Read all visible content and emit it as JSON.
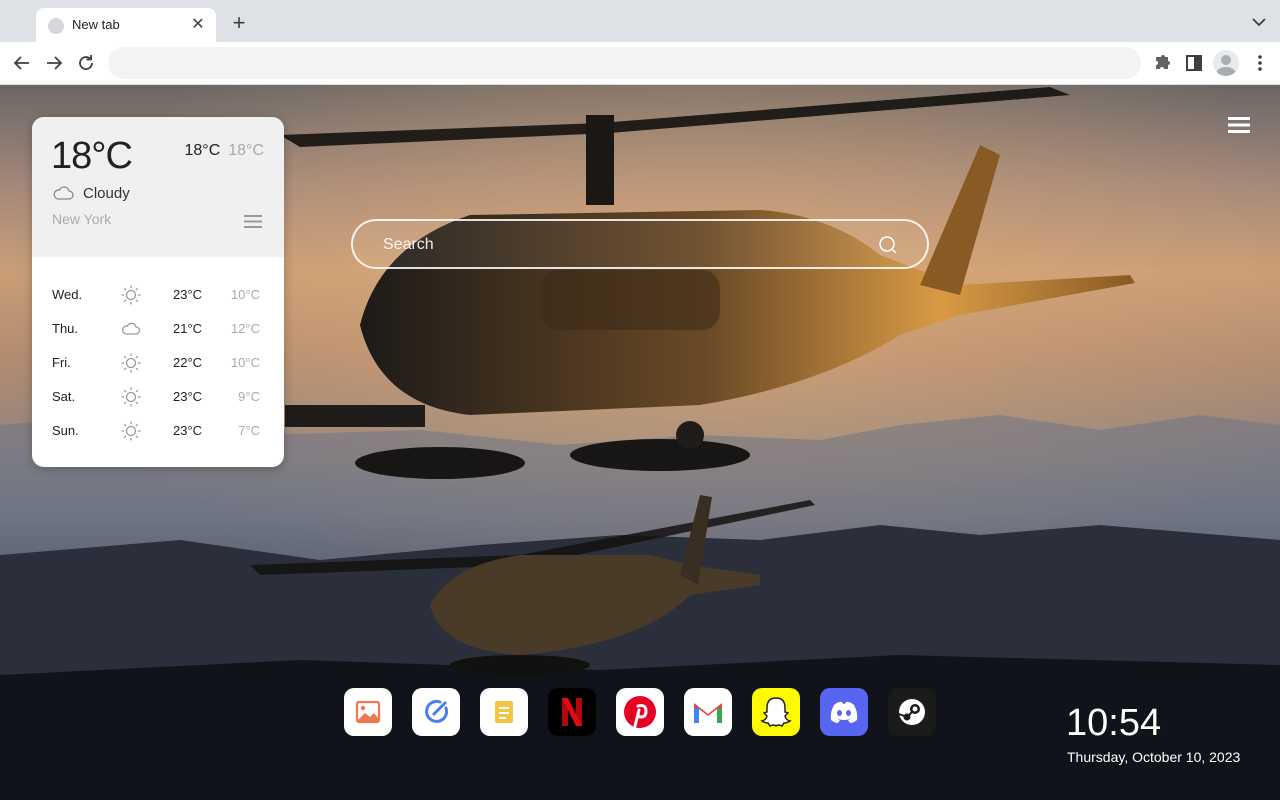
{
  "browser": {
    "tab": {
      "title": "New tab"
    },
    "omnibox": {
      "value": "",
      "placeholder": ""
    }
  },
  "weather": {
    "current_temp": "18°C",
    "high": "18°C",
    "low": "18°C",
    "condition": "Cloudy",
    "condition_icon": "cloud-icon",
    "city": "New York",
    "forecast": [
      {
        "day": "Wed.",
        "icon": "sun-icon",
        "high": "23°C",
        "low": "10°C"
      },
      {
        "day": "Thu.",
        "icon": "cloud-icon",
        "high": "21°C",
        "low": "12°C"
      },
      {
        "day": "Fri.",
        "icon": "sun-icon",
        "high": "22°C",
        "low": "10°C"
      },
      {
        "day": "Sat.",
        "icon": "sun-icon",
        "high": "23°C",
        "low": "9°C"
      },
      {
        "day": "Sun.",
        "icon": "sun-icon",
        "high": "23°C",
        "low": "7°C"
      }
    ]
  },
  "search": {
    "placeholder": "Search"
  },
  "dock": {
    "apps": [
      {
        "name": "Photos",
        "icon": "photos-icon",
        "color": "#ffffff"
      },
      {
        "name": "Tasks",
        "icon": "tasks-icon",
        "color": "#ffffff"
      },
      {
        "name": "Notes",
        "icon": "notes-icon",
        "color": "#ffffff"
      },
      {
        "name": "Netflix",
        "icon": "netflix-icon",
        "color": "#000000"
      },
      {
        "name": "Pinterest",
        "icon": "pinterest-icon",
        "color": "#e60023"
      },
      {
        "name": "Gmail",
        "icon": "gmail-icon",
        "color": "#ea4335"
      },
      {
        "name": "Snapchat",
        "icon": "snapchat-icon",
        "color": "#fffc00"
      },
      {
        "name": "Discord",
        "icon": "discord-icon",
        "color": "#5865f2"
      },
      {
        "name": "Steam",
        "icon": "steam-icon",
        "color": "#1b1b1b"
      }
    ]
  },
  "clock": {
    "time": "10:54",
    "date": "Thursday, October 10, 2023"
  }
}
